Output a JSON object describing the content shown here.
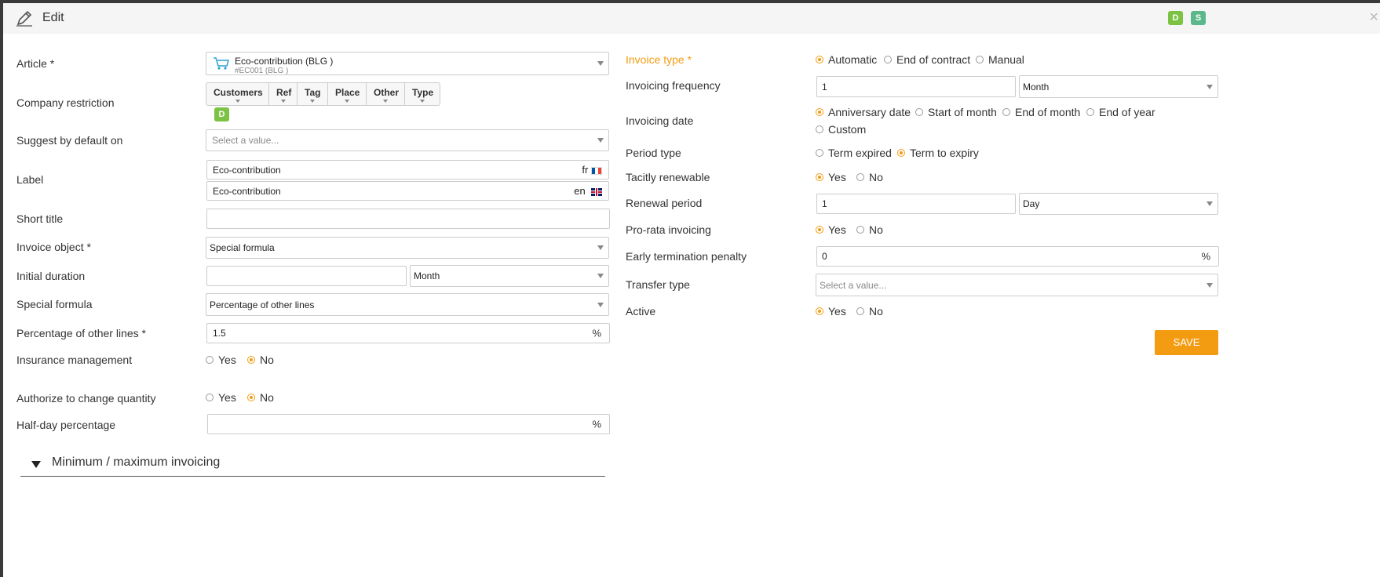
{
  "header": {
    "title": "Edit",
    "badge_d": "D",
    "badge_s": "S",
    "close": "×"
  },
  "colors": {
    "accent": "#f39c12",
    "badge_d": "#7cc243",
    "badge_s": "#5cb88a"
  },
  "left": {
    "article": {
      "label": "Article *",
      "name": "Eco-contribution (BLG )",
      "code": "#EC001 (BLG )",
      "icon": "cart-icon"
    },
    "company_restriction": {
      "label": "Company restriction",
      "buttons": [
        "Customers",
        "Ref",
        "Tag",
        "Place",
        "Other",
        "Type"
      ],
      "badge": "D"
    },
    "suggest_default": {
      "label": "Suggest by default on",
      "placeholder": "Select a value..."
    },
    "label": {
      "label": "Label",
      "fr_value": "Eco-contribution",
      "fr_code": "fr",
      "en_value": "Eco-contribution",
      "en_code": "en"
    },
    "short_title": {
      "label": "Short title",
      "value": ""
    },
    "invoice_object": {
      "label": "Invoice object *",
      "value": "Special formula"
    },
    "initial_duration": {
      "label": "Initial duration",
      "value": "",
      "unit": "Month"
    },
    "special_formula": {
      "label": "Special formula",
      "value": "Percentage of other lines"
    },
    "percentage_other_lines": {
      "label": "Percentage of other lines *",
      "value": "1.5",
      "suffix": "%"
    },
    "insurance_management": {
      "label": "Insurance management",
      "yes": "Yes",
      "no": "No",
      "selected": "No"
    },
    "authorize_quantity": {
      "label": "Authorize to change quantity",
      "yes": "Yes",
      "no": "No",
      "selected": "No"
    },
    "half_day_percentage": {
      "label": "Half-day percentage",
      "value": "",
      "suffix": "%"
    },
    "section_minmax": {
      "title": "Minimum / maximum invoicing"
    }
  },
  "right": {
    "invoice_type": {
      "label": "Invoice type *",
      "options": [
        "Automatic",
        "End of contract",
        "Manual"
      ],
      "selected": "Automatic"
    },
    "invoicing_frequency": {
      "label": "Invoicing frequency",
      "value": "1",
      "unit": "Month"
    },
    "invoicing_date": {
      "label": "Invoicing date",
      "options": [
        "Anniversary date",
        "Start of month",
        "End of month",
        "End of year",
        "Custom"
      ],
      "selected": "Anniversary date"
    },
    "period_type": {
      "label": "Period type",
      "options": [
        "Term expired",
        "Term to expiry"
      ],
      "selected": "Term to expiry"
    },
    "tacitly_renewable": {
      "label": "Tacitly renewable",
      "yes": "Yes",
      "no": "No",
      "selected": "Yes"
    },
    "renewal_period": {
      "label": "Renewal period",
      "value": "1",
      "unit": "Day"
    },
    "prorata_invoicing": {
      "label": "Pro-rata invoicing",
      "yes": "Yes",
      "no": "No",
      "selected": "Yes"
    },
    "early_termination": {
      "label": "Early termination penalty",
      "value": "0",
      "suffix": "%"
    },
    "transfer_type": {
      "label": "Transfer type",
      "placeholder": "Select a value..."
    },
    "active": {
      "label": "Active",
      "yes": "Yes",
      "no": "No",
      "selected": "Yes"
    },
    "save_label": "SAVE"
  }
}
